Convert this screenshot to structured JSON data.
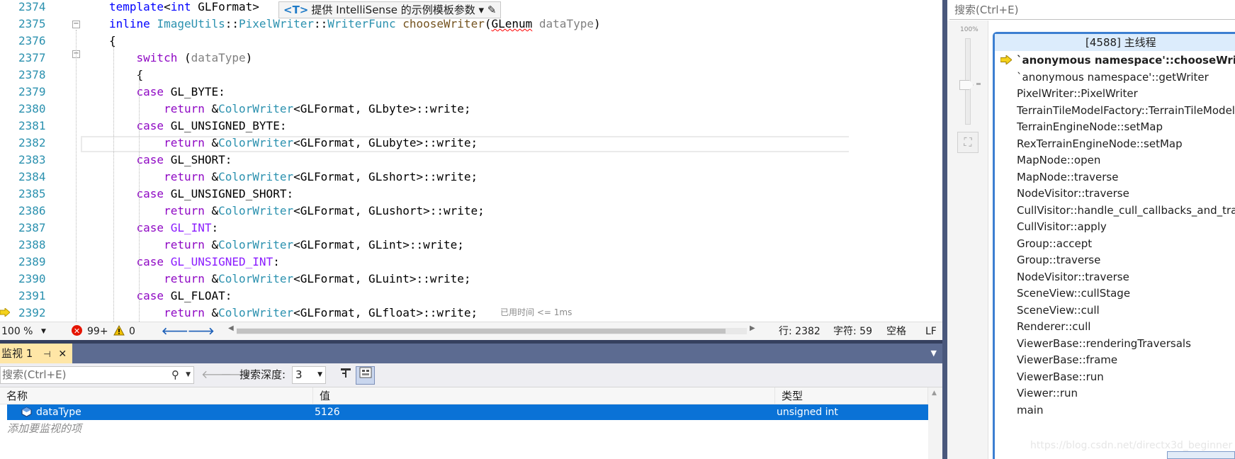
{
  "editor": {
    "lines": [
      {
        "n": "2374",
        "html": "<span class=\"kw\">template</span>&lt;<span class=\"kw\">int</span> GLFormat&gt;"
      },
      {
        "n": "2375",
        "html": "<span class=\"kw\">inline</span> <span class=\"ty\">ImageUtils</span>::<span class=\"ty\">PixelWriter</span>::<span class=\"ty\">WriterFunc</span> <span class=\"fn\">chooseWriter</span>(<span class=\"squig\">GLenum</span> <span class=\"par\">dataType</span>)"
      },
      {
        "n": "2376",
        "html": "{"
      },
      {
        "n": "2377",
        "html": "    <span class=\"kwc\">switch</span> (<span class=\"par\">dataType</span>)"
      },
      {
        "n": "2378",
        "html": "    {"
      },
      {
        "n": "2379",
        "html": "    <span class=\"kwc\">case</span> GL_BYTE:"
      },
      {
        "n": "2380",
        "html": "        <span class=\"kwc\">return</span> &amp;<span class=\"ty\">ColorWriter</span>&lt;GLFormat, GLbyte&gt;::write;"
      },
      {
        "n": "2381",
        "html": "    <span class=\"kwc\">case</span> GL_UNSIGNED_BYTE:"
      },
      {
        "n": "2382",
        "html": "        <span class=\"kwc\">return</span> &amp;<span class=\"ty\">ColorWriter</span>&lt;GLFormat, GLubyte&gt;::write;"
      },
      {
        "n": "2383",
        "html": "    <span class=\"kwc\">case</span> GL_SHORT:"
      },
      {
        "n": "2384",
        "html": "        <span class=\"kwc\">return</span> &amp;<span class=\"ty\">ColorWriter</span>&lt;GLFormat, GLshort&gt;::write;"
      },
      {
        "n": "2385",
        "html": "    <span class=\"kwc\">case</span> GL_UNSIGNED_SHORT:"
      },
      {
        "n": "2386",
        "html": "        <span class=\"kwc\">return</span> &amp;<span class=\"ty\">ColorWriter</span>&lt;GLFormat, GLushort&gt;::write;"
      },
      {
        "n": "2387",
        "html": "    <span class=\"kwc\">case</span> <span class=\"mac\">GL_INT</span>:"
      },
      {
        "n": "2388",
        "html": "        <span class=\"kwc\">return</span> &amp;<span class=\"ty\">ColorWriter</span>&lt;GLFormat, GLint&gt;::write;"
      },
      {
        "n": "2389",
        "html": "    <span class=\"kwc\">case</span> <span class=\"mac\">GL_UNSIGNED_INT</span>:"
      },
      {
        "n": "2390",
        "html": "        <span class=\"kwc\">return</span> &amp;<span class=\"ty\">ColorWriter</span>&lt;GLFormat, GLuint&gt;::write;"
      },
      {
        "n": "2391",
        "html": "    <span class=\"kwc\">case</span> GL_FLOAT:"
      },
      {
        "n": "2392",
        "html": "        <span class=\"kwc\">return</span> &amp;<span class=\"ty\">ColorWriter</span>&lt;GLFormat, GLfloat&gt;::write;"
      }
    ],
    "intellisense_hint": {
      "tag": "<T>",
      "text": "提供 IntelliSense 的示例模板参数",
      "dropdown": "▾",
      "edit": "✎"
    },
    "elapsed": "已用时间 <= 1ms"
  },
  "statusbar": {
    "zoom": "100 %",
    "errors": "99+",
    "warnings": "0",
    "line": "行: 2382",
    "char": "字符: 59",
    "spaces": "空格",
    "eol": "LF"
  },
  "watch": {
    "tab": "监视 1",
    "search_placeholder": "搜索(Ctrl+E)",
    "depth_label": "搜索深度:",
    "depth_value": "3",
    "columns": {
      "name": "名称",
      "value": "值",
      "type": "类型"
    },
    "rows": [
      {
        "name": "dataType",
        "value": "5126",
        "type": "unsigned int"
      }
    ],
    "add_item": "添加要监视的项"
  },
  "callstack": {
    "search_placeholder": "搜索(Ctrl+E)",
    "zoom_label": "100%",
    "thread": "[4588] 主线程",
    "frames": [
      "`anonymous namespace'::chooseWriter<>",
      "`anonymous namespace'::getWriter",
      "PixelWriter::PixelWriter",
      "TerrainTileModelFactory::TerrainTileModelFac...",
      "TerrainEngineNode::setMap",
      "RexTerrainEngineNode::setMap",
      "MapNode::open",
      "MapNode::traverse",
      "NodeVisitor::traverse",
      "CullVisitor::handle_cull_callbacks_and_traverse",
      "CullVisitor::apply",
      "Group::accept",
      "Group::traverse",
      "NodeVisitor::traverse",
      "SceneView::cullStage",
      "SceneView::cull",
      "Renderer::cull",
      "ViewerBase::renderingTraversals",
      "ViewerBase::frame",
      "ViewerBase::run",
      "Viewer::run",
      "main"
    ],
    "watermark": "https://blog.csdn.net/directx3d_beginner"
  },
  "colors": {
    "accent": "#0a72d6",
    "tab_active": "#ffe6a6",
    "toolbar_dark": "#5c6b91",
    "error_red": "#e51400",
    "warning_yellow": "#f0c000"
  }
}
